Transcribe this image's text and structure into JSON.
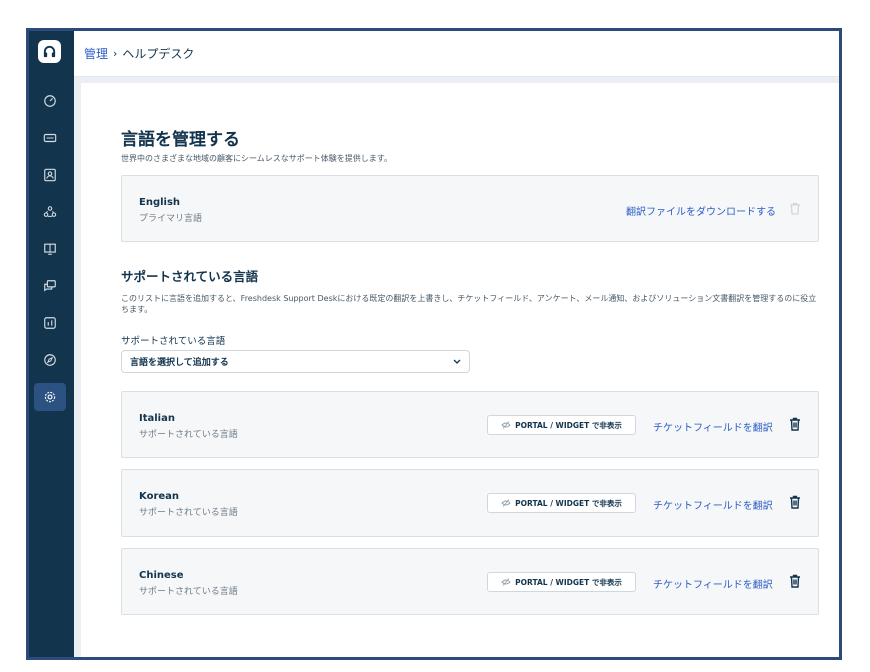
{
  "breadcrumb": {
    "parent": "管理",
    "separator": "›",
    "current": "ヘルプデスク"
  },
  "sidebar": {
    "items": [
      {
        "icon": "dashboard-icon"
      },
      {
        "icon": "ticket-icon"
      },
      {
        "icon": "contact-icon"
      },
      {
        "icon": "users-group-icon"
      },
      {
        "icon": "book-icon"
      },
      {
        "icon": "chat-icon"
      },
      {
        "icon": "analytics-icon"
      },
      {
        "icon": "compass-icon"
      },
      {
        "icon": "gear-icon",
        "active": true
      }
    ]
  },
  "page": {
    "title": "言語を管理する",
    "subtitle": "世界中のさまざまな地域の顧客にシームレスなサポート体験を提供します。"
  },
  "primary": {
    "name": "English",
    "label": "プライマリ言語",
    "download_link": "翻訳ファイルをダウンロードする"
  },
  "supported": {
    "heading": "サポートされている言語",
    "description": "このリストに言語を追加すると、Freshdesk Support Deskにおける既定の翻訳を上書きし、チケットフィールド、アンケート、メール通知、およびソリューション文書翻訳を管理するのに役立ちます。",
    "field_label": "サポートされている言語",
    "select_value": "言語を選択して追加する",
    "languages": [
      {
        "name": "Italian",
        "label": "サポートされている言語",
        "hide_button": "PORTAL / WIDGET で非表示",
        "translate_link": "チケットフィールドを翻訳"
      },
      {
        "name": "Korean",
        "label": "サポートされている言語",
        "hide_button": "PORTAL / WIDGET で非表示",
        "translate_link": "チケットフィールドを翻訳"
      },
      {
        "name": "Chinese",
        "label": "サポートされている言語",
        "hide_button": "PORTAL / WIDGET で非表示",
        "translate_link": "チケットフィールドを翻訳"
      }
    ]
  },
  "colors": {
    "sidebar": "#12344d",
    "link": "#2c5cc5",
    "active": "#2c5282",
    "frame": "#2c4a7a"
  }
}
